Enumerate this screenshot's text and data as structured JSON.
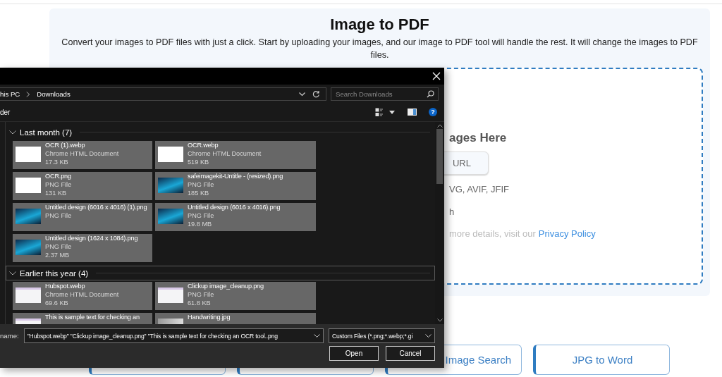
{
  "page": {
    "title": "Image to PDF",
    "description": "Convert your images to PDF files with just a click. Start by uploading your images, and our image to PDF tool will handle the rest. It will change the images to PDF files.",
    "dropzone": {
      "heading": "ages Here",
      "url_button": "URL",
      "formats": "VG, AVIF, JFIF",
      "line_2": "h",
      "privacy_text": "more details, visit our",
      "privacy_link": "Privacy Policy"
    },
    "tool_buttons": [
      {
        "kind": "covered"
      },
      {
        "kind": "covered"
      },
      {
        "kind": "partly_covered",
        "label": "Image Search"
      },
      {
        "kind": "labeled",
        "label": "JPG to Word"
      }
    ]
  },
  "dialog": {
    "breadcrumb": [
      "his PC",
      "Downloads"
    ],
    "search": {
      "placeholder": "Search Downloads"
    },
    "toolbar": {
      "new_folder": "der",
      "help": "?"
    },
    "groups": [
      {
        "title": "Last month (7)",
        "focused": false,
        "files": [
          {
            "name": "OCR (1).webp",
            "type": "Chrome HTML Document",
            "size": "17.3 KB",
            "kind": "diagram",
            "selected": true
          },
          {
            "name": "OCR.webp",
            "type": "Chrome HTML Document",
            "size": "519 KB",
            "kind": "diagram",
            "selected": true
          },
          {
            "name": "OCR.png",
            "type": "PNG File",
            "size": "131 KB",
            "kind": "diagram",
            "selected": true
          },
          {
            "name": "safeimagekit-Untitle - (resized).png",
            "type": "PNG File",
            "size": "185 KB",
            "kind": "design",
            "selected": true
          },
          {
            "name": "Untitled design (6016 x 4016) (1).png",
            "type": "PNG File",
            "kind": "design",
            "selected": true
          },
          {
            "name": "Untitled design (6016 x 4016).png",
            "type": "PNG File",
            "size": "19.8 MB",
            "kind": "design",
            "selected": true
          },
          {
            "name": "Untitled design (1624 x 1084).png",
            "type": "PNG File",
            "size": "2.37 MB",
            "kind": "design",
            "selected": true
          }
        ]
      },
      {
        "title": "Earlier this year (4)",
        "focused": true,
        "files": [
          {
            "name": "Hubspot.webp",
            "type": "Chrome HTML Document",
            "size": "69.6 KB",
            "kind": "document",
            "selected": true
          },
          {
            "name": "Clickup image_cleanup.png",
            "type": "PNG File",
            "size": "61.8 KB",
            "kind": "document",
            "selected": true
          },
          {
            "name": "This is sample text for checking an",
            "kind": "document",
            "selected": true
          },
          {
            "name": "Handwriting.jpg",
            "kind": "photo",
            "selected": true
          }
        ]
      }
    ],
    "filename_label": "name:",
    "filename_value": "\"Hubspot.webp\" \"Clickup image_cleanup.png\" \"This is sample text for checking an OCR tool..png",
    "filter": "Custom Files (*.png;*.webp;*.gi",
    "buttons": [
      "Open",
      "Cancel"
    ]
  }
}
